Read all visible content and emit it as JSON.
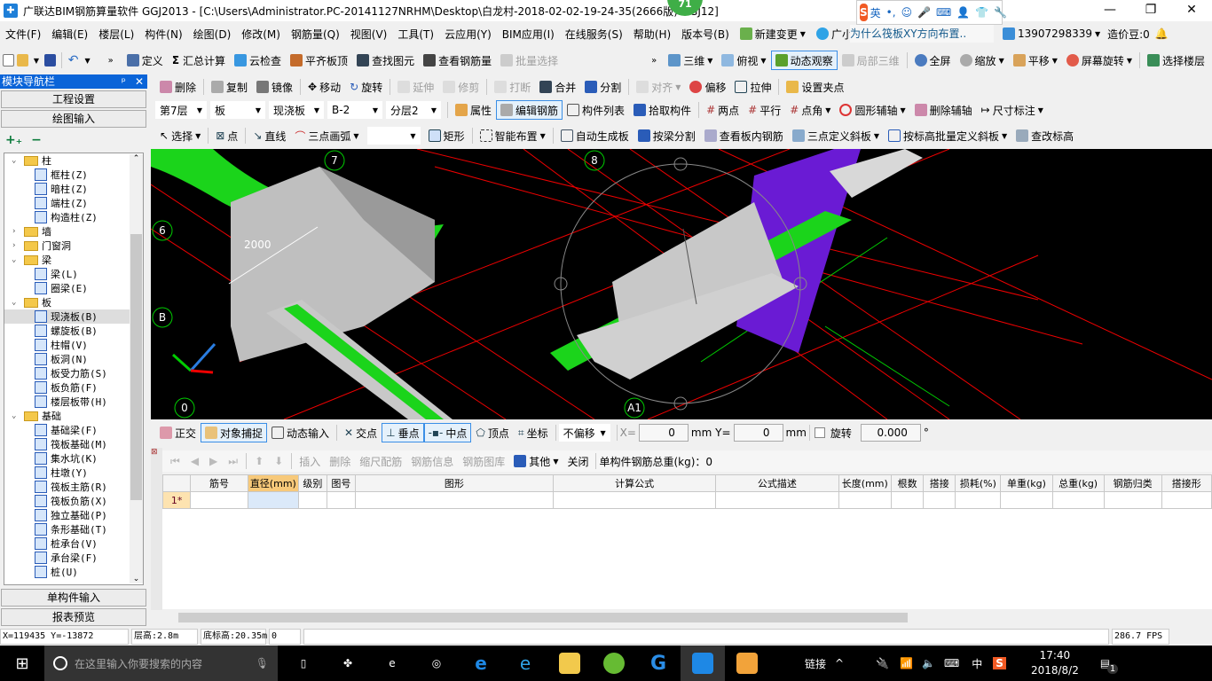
{
  "title": {
    "text": "广联达BIM钢筋算量软件 GGJ2013 - [C:\\Users\\Administrator.PC-20141127NRHM\\Desktop\\白龙村-2018-02-02-19-24-35(2666版).GGJ12]",
    "badge": "71",
    "ime": [
      "英",
      "•,",
      "☺",
      "🎤",
      "⌨",
      "👤",
      "👕",
      "🔧"
    ],
    "min": "—",
    "max": "❐",
    "close": "✕"
  },
  "menu": [
    "文件(F)",
    "编辑(E)",
    "楼层(L)",
    "构件(N)",
    "绘图(D)",
    "修改(M)",
    "钢筋量(Q)",
    "视图(V)",
    "工具(T)",
    "云应用(Y)",
    "BIM应用(I)",
    "在线服务(S)",
    "帮助(H)",
    "版本号(B)",
    "新建变更",
    "广小二"
  ],
  "news": "为什么筏板XY方向布置..",
  "user": {
    "phone": "13907298339",
    "beans": "造价豆:0"
  },
  "toolbar1": [
    "定义",
    "汇总计算",
    "云检查",
    "平齐板顶",
    "查找图元",
    "查看钢筋量",
    "批量选择",
    "三维",
    "俯视",
    "动态观察",
    "局部三维",
    "全屏",
    "缩放",
    "平移",
    "屏幕旋转",
    "选择楼层"
  ],
  "toolbar2": [
    "删除",
    "复制",
    "镜像",
    "移动",
    "旋转",
    "延伸",
    "修剪",
    "打断",
    "合并",
    "分割",
    "对齐",
    "偏移",
    "拉伸",
    "设置夹点"
  ],
  "selectors": [
    "第7层",
    "板",
    "现浇板",
    "B-2",
    "分层2"
  ],
  "toolbar3": [
    "属性",
    "编辑钢筋",
    "构件列表",
    "拾取构件",
    "两点",
    "平行",
    "点角",
    "圆形辅轴",
    "删除辅轴",
    "尺寸标注"
  ],
  "toolbar4": [
    "选择",
    "点",
    "直线",
    "三点画弧",
    "",
    "矩形",
    "智能布置",
    "自动生成板",
    "按梁分割",
    "查看板内钢筋",
    "三点定义斜板",
    "按标高批量定义斜板",
    "查改标高"
  ],
  "nav": {
    "title": "模块导航栏",
    "pin": "ᵖ",
    "close": "✕",
    "top_buttons": [
      "工程设置",
      "绘图输入"
    ],
    "bottom_buttons": [
      "单构件输入",
      "报表预览"
    ],
    "tree": [
      {
        "l": 0,
        "t": "柱",
        "open": true
      },
      {
        "l": 1,
        "t": "框柱(Z)"
      },
      {
        "l": 1,
        "t": "暗柱(Z)"
      },
      {
        "l": 1,
        "t": "端柱(Z)"
      },
      {
        "l": 1,
        "t": "构造柱(Z)"
      },
      {
        "l": 0,
        "t": "墙",
        "open": false
      },
      {
        "l": 0,
        "t": "门窗洞",
        "open": false
      },
      {
        "l": 0,
        "t": "梁",
        "open": true
      },
      {
        "l": 1,
        "t": "梁(L)"
      },
      {
        "l": 1,
        "t": "圈梁(E)"
      },
      {
        "l": 0,
        "t": "板",
        "open": true
      },
      {
        "l": 1,
        "t": "现浇板(B)",
        "sel": true
      },
      {
        "l": 1,
        "t": "螺旋板(B)"
      },
      {
        "l": 1,
        "t": "柱帽(V)"
      },
      {
        "l": 1,
        "t": "板洞(N)"
      },
      {
        "l": 1,
        "t": "板受力筋(S)"
      },
      {
        "l": 1,
        "t": "板负筋(F)"
      },
      {
        "l": 1,
        "t": "楼层板带(H)"
      },
      {
        "l": 0,
        "t": "基础",
        "open": true
      },
      {
        "l": 1,
        "t": "基础梁(F)"
      },
      {
        "l": 1,
        "t": "筏板基础(M)"
      },
      {
        "l": 1,
        "t": "集水坑(K)"
      },
      {
        "l": 1,
        "t": "柱墩(Y)"
      },
      {
        "l": 1,
        "t": "筏板主筋(R)"
      },
      {
        "l": 1,
        "t": "筏板负筋(X)"
      },
      {
        "l": 1,
        "t": "独立基础(P)"
      },
      {
        "l": 1,
        "t": "条形基础(T)"
      },
      {
        "l": 1,
        "t": "桩承台(V)"
      },
      {
        "l": 1,
        "t": "承台梁(F)"
      },
      {
        "l": 1,
        "t": "桩(U)"
      }
    ]
  },
  "canvas": {
    "axes": [
      "7",
      "8",
      "6",
      "B",
      "0",
      "A1"
    ],
    "dimension": "2000"
  },
  "snap": {
    "buttons": [
      "正交",
      "对象捕捉",
      "动态输入",
      "交点",
      "垂点",
      "中点",
      "顶点",
      "坐标"
    ],
    "offset": "不偏移",
    "x_label": "X=",
    "x": "0",
    "y_label": "mm Y=",
    "y": "0",
    "mm": "mm",
    "rotate": "旋转",
    "angle": "0.000",
    "deg": "°"
  },
  "gridbar": {
    "buttons": [
      "插入",
      "删除",
      "缩尺配筋",
      "钢筋信息",
      "钢筋图库",
      "其他",
      "关闭"
    ],
    "total": "单构件钢筋总重(kg)：0"
  },
  "grid": {
    "headers": [
      "",
      "筋号",
      "直径(mm)",
      "级别",
      "图号",
      "图形",
      "计算公式",
      "公式描述",
      "长度(mm)",
      "根数",
      "搭接",
      "损耗(%)",
      "单重(kg)",
      "总重(kg)",
      "钢筋归类",
      "搭接形"
    ],
    "rows": [
      [
        "1*",
        "",
        "",
        "",
        "",
        "",
        "",
        "",
        "",
        "",
        "",
        "",
        "",
        "",
        "",
        ""
      ]
    ]
  },
  "status": {
    "coords": "X=119435 Y=-13872",
    "floor_h": "层高:2.8m",
    "base_h": "底标高:20.35m",
    "val": "0",
    "fps": "286.7 FPS"
  },
  "taskbar": {
    "search": "在这里输入你要搜索的内容",
    "link": "链接",
    "lang": "中",
    "time": "17:40",
    "date": "2018/8/2",
    "notif": "1"
  }
}
